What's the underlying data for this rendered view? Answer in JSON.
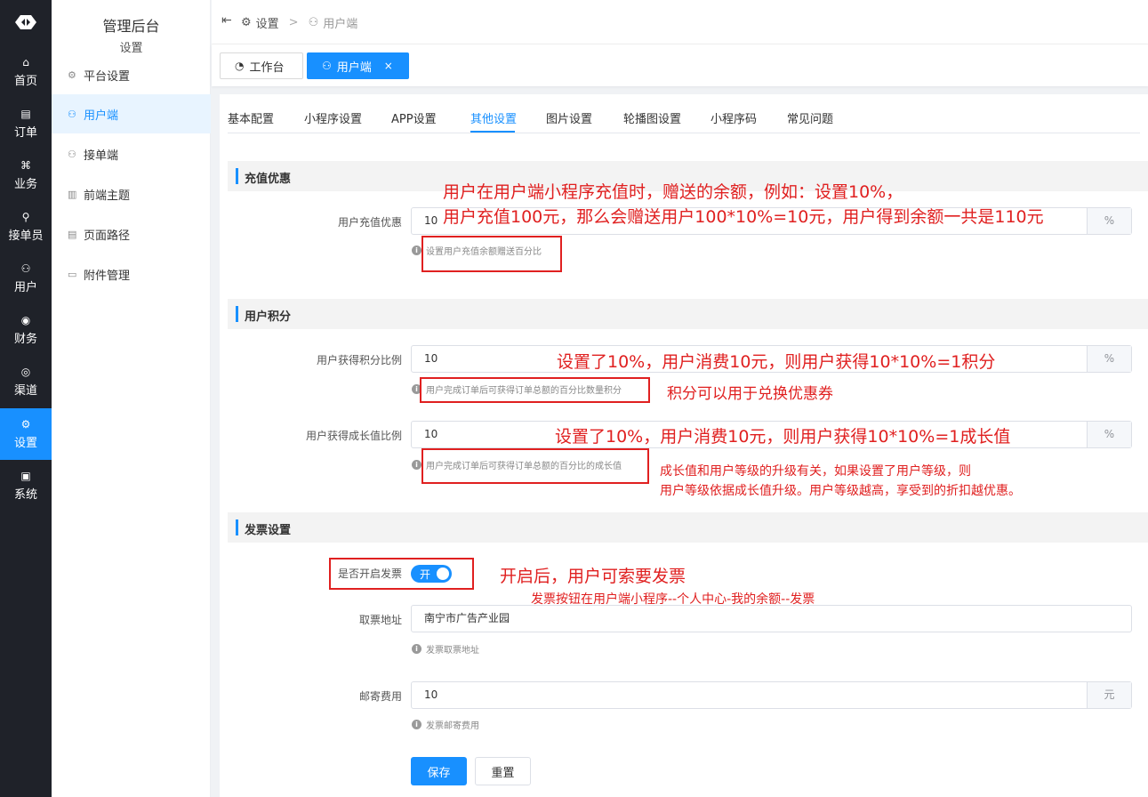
{
  "rail": {
    "items": [
      {
        "icon": "home-icon",
        "glyph": "⌂",
        "label": "首页"
      },
      {
        "icon": "order-icon",
        "glyph": "▤",
        "label": "订单"
      },
      {
        "icon": "business-icon",
        "glyph": "⌘",
        "label": "业务"
      },
      {
        "icon": "bike-icon",
        "glyph": "⚲",
        "label": "接单员"
      },
      {
        "icon": "user-icon",
        "glyph": "⚇",
        "label": "用户"
      },
      {
        "icon": "finance-icon",
        "glyph": "◉",
        "label": "财务"
      },
      {
        "icon": "channel-icon",
        "glyph": "◎",
        "label": "渠道"
      },
      {
        "icon": "settings-icon",
        "glyph": "⚙",
        "label": "设置"
      },
      {
        "icon": "system-icon",
        "glyph": "▣",
        "label": "系统"
      }
    ]
  },
  "submenu": {
    "title": "管理后台",
    "subtitle": "设置",
    "items": [
      {
        "glyph": "⚙",
        "label": "平台设置"
      },
      {
        "glyph": "⚇",
        "label": "用户端"
      },
      {
        "glyph": "⚇",
        "label": "接单端"
      },
      {
        "glyph": "▥",
        "label": "前端主题"
      },
      {
        "glyph": "▤",
        "label": "页面路径"
      },
      {
        "glyph": "▭",
        "label": "附件管理"
      }
    ]
  },
  "header": {
    "breadcrumb": [
      "设置",
      "用户端"
    ],
    "separator": ">"
  },
  "tags": {
    "items": [
      {
        "label": "工作台"
      },
      {
        "label": "用户端",
        "close": "×"
      }
    ]
  },
  "tabs": [
    "基本配置",
    "小程序设置",
    "APP设置",
    "其他设置",
    "图片设置",
    "轮播图设置",
    "小程序码",
    "常见问题"
  ],
  "form": {
    "recharge_section": "充值优惠",
    "recharge_label": "用户充值优惠",
    "recharge_value": "10",
    "recharge_unit": "%",
    "recharge_hint": "设置用户充值余额赠送百分比",
    "points_section": "用户积分",
    "points_label": "用户获得积分比例",
    "points_value": "10",
    "points_unit": "%",
    "points_hint": "用户完成订单后可获得订单总额的百分比数量积分",
    "growth_label": "用户获得成长值比例",
    "growth_value": "10",
    "growth_unit": "%",
    "growth_hint": "用户完成订单后可获得订单总额的百分比的成长值",
    "invoice_section": "发票设置",
    "invoice_label": "是否开启发票",
    "invoice_switch_text": "开",
    "invoice_enabled": true,
    "pickup_label": "取票地址",
    "pickup_value": "南宁市广告产业园",
    "pickup_hint": "发票取票地址",
    "postage_label": "邮寄费用",
    "postage_value": "10",
    "postage_unit": "元",
    "postage_hint": "发票邮寄费用",
    "save_button": "保存",
    "reset_button": "重置"
  },
  "annotations": {
    "recharge_line1": "用户在用户端小程序充值时，赠送的余额，例如：设置10%，",
    "recharge_line2": "用户充值100元，那么会赠送用户100*10%=10元，用户得到余额一共是110元",
    "points_line1": "设置了10%，用户消费10元，则用户获得10*10%=1积分",
    "points_line2": "积分可以用于兑换优惠券",
    "growth_line1": "设置了10%，用户消费10元，则用户获得10*10%=1成长值",
    "growth_line2": "成长值和用户等级的升级有关，如果设置了用户等级，则",
    "growth_line3": "用户等级依据成长值升级。用户等级越高，享受到的折扣越优惠。",
    "invoice_line1": "开启后，用户可索要发票",
    "invoice_line2": "发票按钮在用户端小程序--个人中心-我的余额--发票"
  },
  "colors": {
    "accent": "#1890ff",
    "annotation": "#e02020",
    "rail": "#1f2229"
  }
}
